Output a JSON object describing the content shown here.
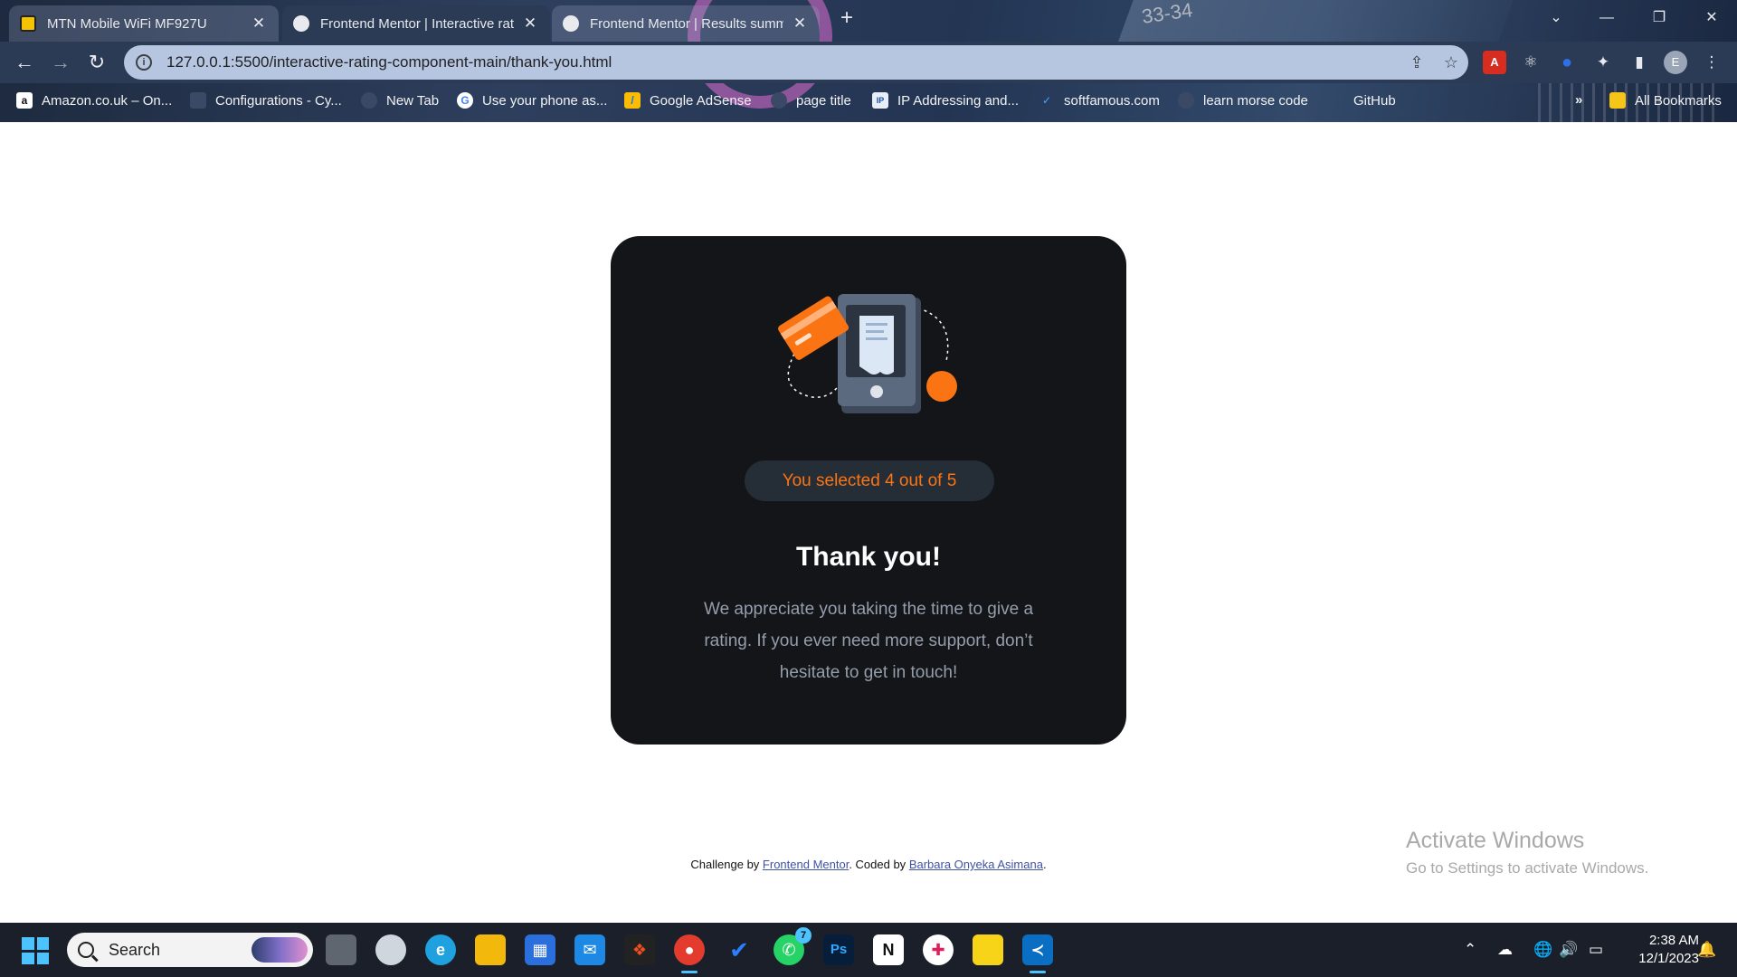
{
  "browser": {
    "tabs": [
      {
        "title": "MTN Mobile WiFi MF927U",
        "favicon": "mtn-favicon",
        "active": false
      },
      {
        "title": "Frontend Mentor | Interactive rat",
        "favicon": "frontend-mentor-favicon",
        "active": true
      },
      {
        "title": "Frontend Mentor | Results summ",
        "favicon": "frontend-mentor-favicon",
        "active": false
      }
    ],
    "new_tab": "+",
    "url": "127.0.0.1:5500/interactive-rating-component-main/thank-you.html",
    "bookmarks": [
      {
        "label": "Amazon.co.uk – On...",
        "icon": "amazon-icon"
      },
      {
        "label": "Configurations - Cy...",
        "icon": "config-icon"
      },
      {
        "label": "New Tab",
        "icon": "newtab-icon"
      },
      {
        "label": "Use your phone as...",
        "icon": "google-icon"
      },
      {
        "label": "Google AdSense",
        "icon": "adsense-icon"
      },
      {
        "label": "page title",
        "icon": "page-icon"
      },
      {
        "label": "IP Addressing and...",
        "icon": "ip-icon"
      },
      {
        "label": "softfamous.com",
        "icon": "softfamous-icon"
      },
      {
        "label": "learn morse code",
        "icon": "morse-icon"
      },
      {
        "label": "GitHub",
        "icon": "github-icon"
      }
    ],
    "bookmarks_more": "»",
    "all_bookmarks": "All Bookmarks",
    "profile_initial": "E",
    "wallpaper_text": "33-34"
  },
  "card": {
    "selection": "You selected 4 out of 5",
    "heading": "Thank you!",
    "message": "We appreciate you taking the time to give a rating. If you ever need more support, don’t hesitate to get in touch!"
  },
  "attribution": {
    "prefix": "Challenge by ",
    "link1": "Frontend Mentor",
    "middle": ". Coded by ",
    "link2": "Barbara Onyeka Asimana",
    "suffix": "."
  },
  "watermark": {
    "title": "Activate Windows",
    "subtitle": "Go to Settings to activate Windows."
  },
  "taskbar": {
    "search_placeholder": "Search",
    "whatsapp_badge": "7",
    "time": "2:38 AM",
    "date": "12/1/2023"
  },
  "colors": {
    "card_bg": "#131518",
    "accent_orange": "#fb7413",
    "pill_bg": "#252d37",
    "body_text": "#959eac"
  }
}
